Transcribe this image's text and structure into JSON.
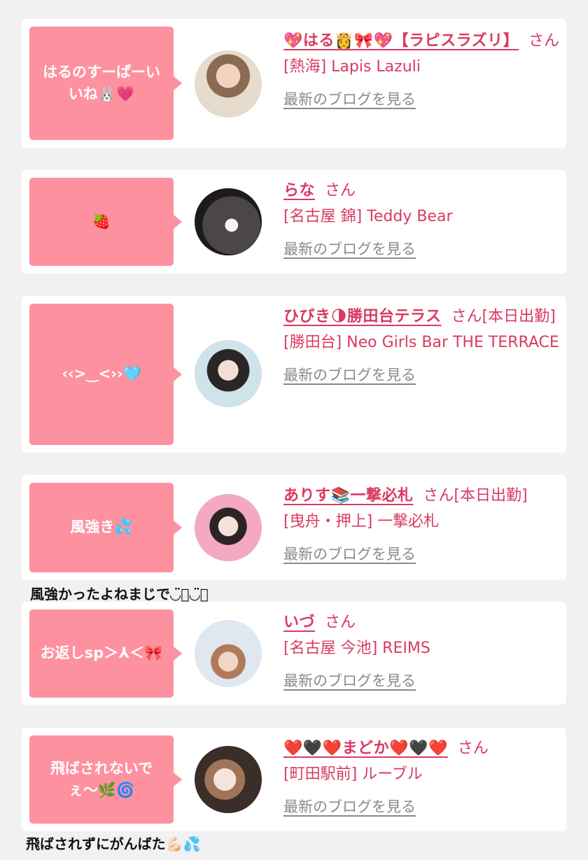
{
  "blog_label": "最新のブログを見る",
  "cards": [
    {
      "bubble": "はるのすーぱーいいね🐰💗",
      "name": "💖はる👸🎀💖【ラピスラズリ】",
      "suffix": "さん",
      "shop": "[熱海] Lapis Lazuli"
    },
    {
      "bubble": "🍓",
      "name": "らな",
      "suffix": "さん",
      "shop": "[名古屋 錦] Teddy Bear"
    },
    {
      "bubble": "‹‹>‿<››🩵",
      "name": "ひびき🌗勝田台テラス",
      "suffix": "さん[本日出勤]",
      "shop": "[勝田台] Neo Girls Bar THE TERRACE"
    },
    {
      "bubble": "風強き💦",
      "name": "ありす📚一撃必札",
      "suffix": "さん[本日出勤]",
      "shop": "[曳舟・押上] 一撃必札"
    },
    {
      "bubble": "お返しsp＞⅄＜🎀",
      "name": "いづ",
      "suffix": "さん",
      "shop": "[名古屋 今池] REIMS"
    },
    {
      "bubble": "飛ばされないでぇ〜🌿🌀",
      "name": "❤️🖤❤️まどか❤️🖤❤️",
      "suffix": "さん",
      "shop": "[町田駅前] ルーブル"
    }
  ],
  "comments": [
    "風強かったよねまじで◡̈⃝︎◡̈⃝︎",
    "飛ばされずにがんばた💪🏻💦"
  ]
}
